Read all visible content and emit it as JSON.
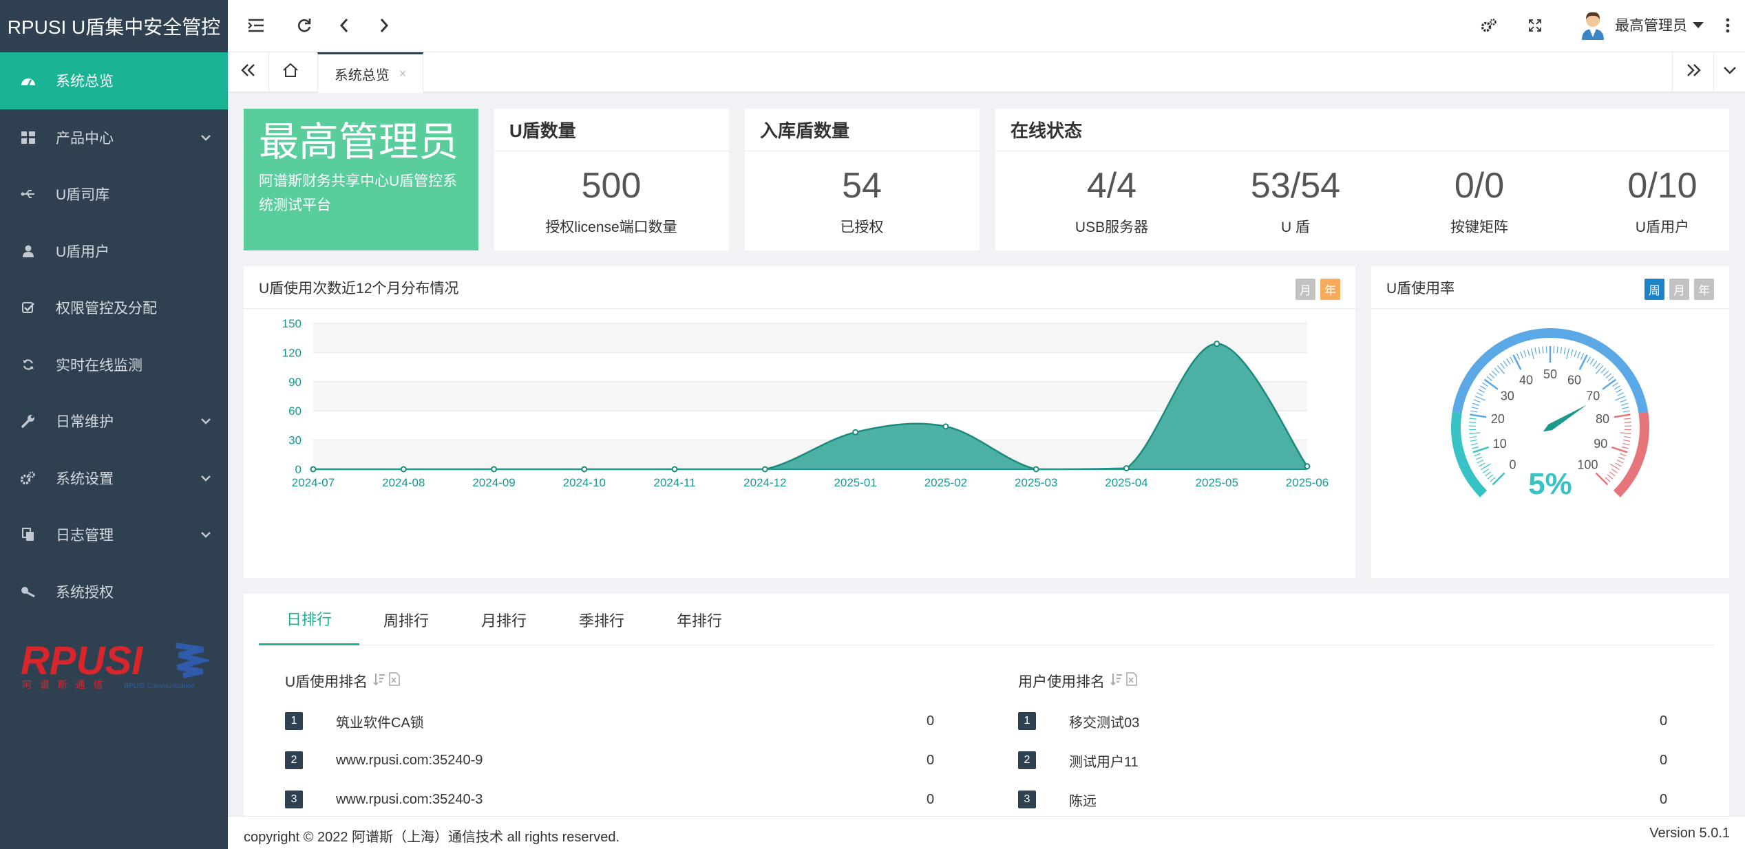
{
  "app": {
    "title": "RPUSI U盾集中安全管控"
  },
  "sidebar": {
    "items": [
      {
        "label": "系统总览",
        "icon": "dashboard-icon",
        "active": true
      },
      {
        "label": "产品中心",
        "icon": "grid-icon",
        "has_children": true
      },
      {
        "label": "U盾司库",
        "icon": "usb-icon"
      },
      {
        "label": "U盾用户",
        "icon": "user-icon"
      },
      {
        "label": "权限管控及分配",
        "icon": "checkbox-icon"
      },
      {
        "label": "实时在线监测",
        "icon": "refresh-icon"
      },
      {
        "label": "日常维护",
        "icon": "wrench-icon",
        "has_children": true
      },
      {
        "label": "系统设置",
        "icon": "gears-icon",
        "has_children": true
      },
      {
        "label": "日志管理",
        "icon": "copy-icon",
        "has_children": true
      },
      {
        "label": "系统授权",
        "icon": "key-icon"
      }
    ],
    "logo": {
      "text": "RPUSI",
      "subtext": "阿 谱 斯 通 信",
      "tagline": "RPUSI Communication"
    }
  },
  "topbar": {
    "user": "最高管理员"
  },
  "tabs": {
    "active": "系统总览",
    "close": "×"
  },
  "admin_card": {
    "title": "最高管理员",
    "subtitle": "阿谱斯财务共享中心U盾管控系统测试平台"
  },
  "ud_count": {
    "title": "U盾数量",
    "value": "500",
    "label": "授权license端口数量"
  },
  "stock": {
    "title": "入库盾数量",
    "value": "54",
    "label": "已授权"
  },
  "online": {
    "title": "在线状态",
    "items": [
      {
        "value": "4/4",
        "label": "USB服务器"
      },
      {
        "value": "53/54",
        "label": "U 盾"
      },
      {
        "value": "0/0",
        "label": "按键矩阵"
      },
      {
        "value": "0/10",
        "label": "U盾用户"
      }
    ]
  },
  "usage_panel": {
    "title": "U盾使用次数近12个月分布情况",
    "btn_month": "月",
    "btn_year": "年"
  },
  "rate_panel": {
    "title": "U盾使用率",
    "btn_week": "周",
    "btn_month": "月",
    "btn_year": "年"
  },
  "colors": {
    "accent": "#1ab394",
    "sidebar": "#2f4050",
    "area": "#3aa99c",
    "gauge_blue": "#5aa9e6",
    "gauge_cyan": "#37c2c6",
    "gauge_red": "#e5757a",
    "orange": "#f8ac59",
    "blue": "#1c84c6"
  },
  "chart_data": {
    "type": "area",
    "title": "U盾使用次数近12个月分布情况",
    "categories": [
      "2024-07",
      "2024-08",
      "2024-09",
      "2024-10",
      "2024-11",
      "2024-12",
      "2025-01",
      "2025-02",
      "2025-03",
      "2025-04",
      "2025-05",
      "2025-06"
    ],
    "values": [
      0,
      0,
      0,
      0,
      0,
      0,
      38,
      44,
      0,
      1,
      129,
      3
    ],
    "ylim": [
      0,
      150
    ],
    "yticks": [
      0,
      30,
      60,
      90,
      120,
      150
    ],
    "grid": true
  },
  "gauge": {
    "value": "5%",
    "percent": 5,
    "labels": [
      "0",
      "10",
      "20",
      "30",
      "40",
      "50",
      "60",
      "70",
      "80",
      "90",
      "100"
    ]
  },
  "ranking": {
    "tabs": [
      "日排行",
      "周排行",
      "月排行",
      "季排行",
      "年排行"
    ],
    "left": {
      "title": "U盾使用排名",
      "rows": [
        {
          "rank": "1",
          "name": "筑业软件CA锁",
          "count": "0"
        },
        {
          "rank": "2",
          "name": "www.rpusi.com:35240-9",
          "count": "0"
        },
        {
          "rank": "3",
          "name": "www.rpusi.com:35240-3",
          "count": "0"
        }
      ]
    },
    "right": {
      "title": "用户使用排名",
      "rows": [
        {
          "rank": "1",
          "name": "移交测试03",
          "count": "0"
        },
        {
          "rank": "2",
          "name": "测试用户11",
          "count": "0"
        },
        {
          "rank": "3",
          "name": "陈远",
          "count": "0"
        }
      ]
    }
  },
  "footer": {
    "copyright": "copyright © 2022 阿谱斯（上海）通信技术 all rights reserved.",
    "version": "Version 5.0.1"
  }
}
